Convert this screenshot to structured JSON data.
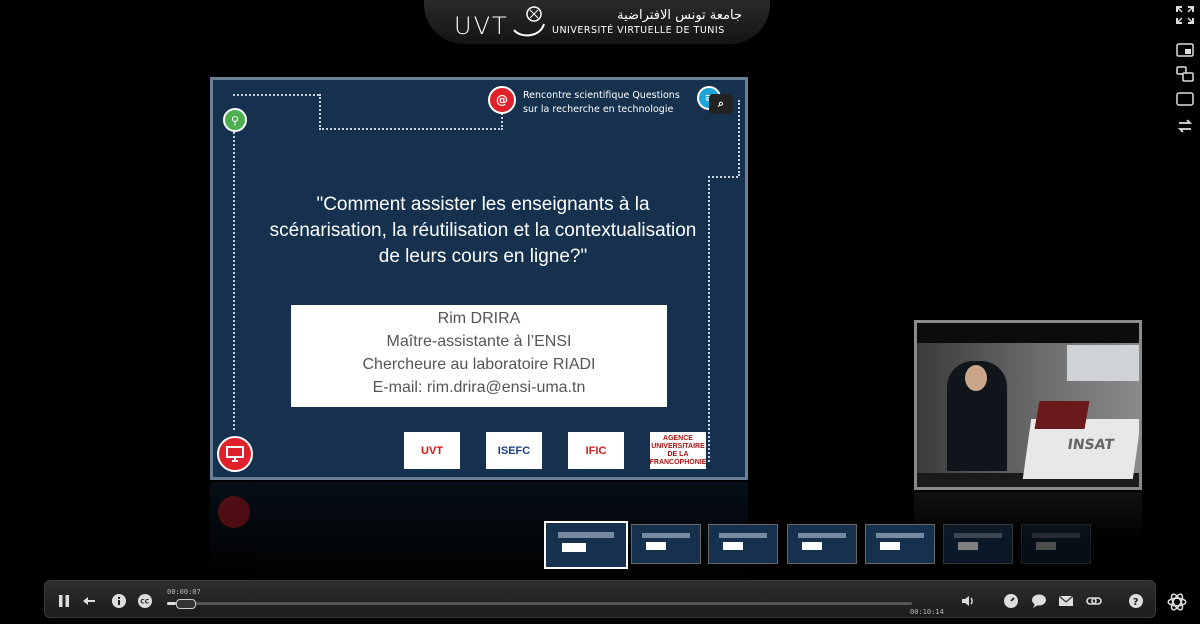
{
  "header": {
    "logo_latin": "UVT",
    "logo_arabic": "جامعة تونس الافتراضية",
    "logo_french": "UNIVERSITÉ VIRTUELLE DE TUNIS"
  },
  "slide": {
    "header_line1": "Rencontre scientifique Questions",
    "header_line2": "sur la recherche en technologie",
    "title_line1": "\"Comment assister les enseignants à la",
    "title_line2": "scénarisation, la réutilisation et la contextualisation",
    "title_line3": "de leurs cours en ligne?\"",
    "author_name": "Rim DRIRA",
    "author_role": "Maître-assistante à l’ENSI",
    "author_lab": "Chercheure au laboratoire RIADI",
    "author_email": "E-mail: rim.drira@ensi-uma.tn",
    "sponsors": [
      "UVT",
      "ISEFC",
      "IFIC",
      "AGENCE UNIVERSITAIRE DE LA FRANCOPHONIE"
    ]
  },
  "video": {
    "podium_text": "INSAT"
  },
  "player": {
    "current_time": "00:00:07",
    "total_time": "00:10:14",
    "progress_fraction": 0.012
  },
  "thumbnails": {
    "count": 7,
    "active_index": 0
  },
  "colors": {
    "slide_bg": "#15314e",
    "accent_red": "#e0202a",
    "accent_green": "#4caf50"
  },
  "icons": {
    "side": [
      "fullscreen-icon",
      "layout-slide-video-icon",
      "layout-pip-icon",
      "layout-single-icon",
      "swap-icon"
    ],
    "controls_left": [
      "pause-icon",
      "rewind-icon",
      "info-icon",
      "closed-captions-icon"
    ],
    "controls_right": [
      "volume-icon",
      "speed-icon",
      "comment-icon",
      "email-icon",
      "link-icon",
      "help-icon",
      "settings-icon"
    ]
  }
}
